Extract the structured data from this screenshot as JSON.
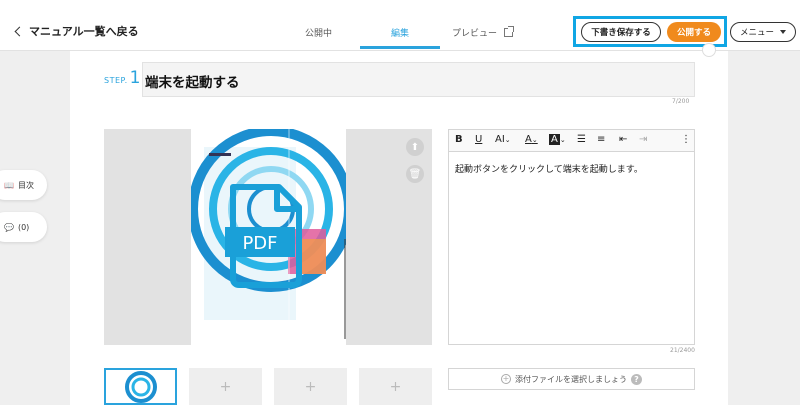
{
  "header": {
    "back_label": "マニュアル一覧へ戻る",
    "tabs": [
      {
        "label": "公開中"
      },
      {
        "label": "編集"
      },
      {
        "label": "プレビュー"
      }
    ],
    "draft_label": "下書き保存する",
    "publish_label": "公開する",
    "menu_label": "メニュー"
  },
  "step": {
    "word": "STEP.",
    "number": "1",
    "title": "端末を起動する",
    "count": "7/200"
  },
  "editor": {
    "toolbar": [
      "B",
      "U",
      "AI",
      "A",
      "A"
    ],
    "text": "起動ボタンをクリックして端末を起動します。",
    "count": "21/2400"
  },
  "attach": {
    "label": "添付ファイルを選択しましょう"
  },
  "doc": {
    "label": "PDF"
  },
  "side": {
    "toc_label": "目次",
    "comments_label": "(0)"
  },
  "colors": {
    "accent": "#2aa3dd",
    "highlight": "#10a6e4",
    "publish": "#f08a1c"
  }
}
